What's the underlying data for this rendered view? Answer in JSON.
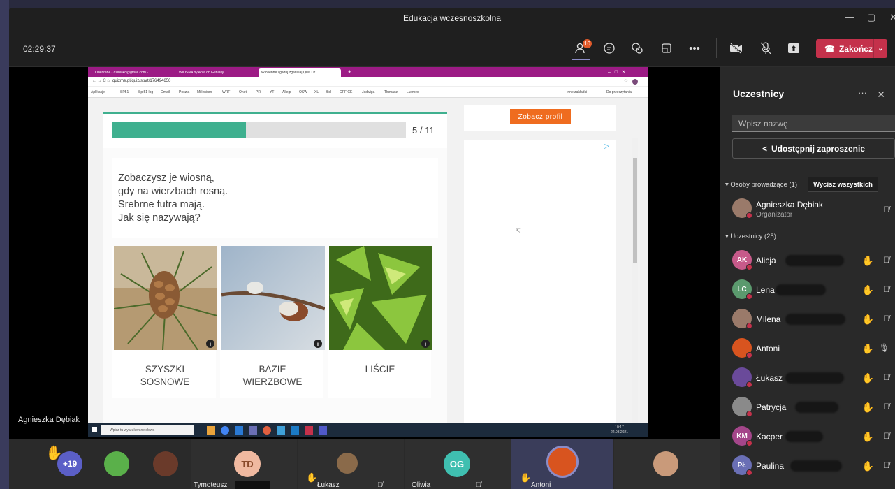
{
  "window": {
    "title": "Edukacja wczesnoszkolna"
  },
  "toolbar": {
    "time": "02:29:37",
    "participants_badge": "10",
    "end_label": "Zakończ"
  },
  "browser": {
    "tabs": [
      "Odebrane - dzibiako@gmail.com - ...",
      "WIOSNA by Ania on Genially",
      "Wiosenne zgaduj zgadula| Quiz Or..."
    ],
    "url": "quizme.pl/quiz/start/176494656",
    "bookmarks": [
      "Aplikacje",
      "SP51",
      "Sp 51 log",
      "Gmail",
      "Poczta",
      "Millenium",
      "WRF",
      "Onet",
      "PR",
      "YT",
      "Allegr",
      "OSW",
      "XL",
      "Bisl",
      "OFFICE",
      "Jadwiga",
      "Tłumacz",
      "Luxmed",
      "Inne zakładki",
      "Do przeczytania"
    ]
  },
  "quiz": {
    "progress": 0.4545,
    "counter": "5 / 11",
    "question": "Zobaczysz je wiosną,\ngdy na wierzbach rosną.\nSrebrne futra mają.\nJak się nazywają?",
    "answers": [
      {
        "label": "SZYSZKI\nSOSNOWE"
      },
      {
        "label": "BAZIE\nWIERZBOWE"
      },
      {
        "label": "LIŚCIE"
      }
    ],
    "profile_button": "Zobacz profil"
  },
  "windows_taskbar": {
    "search_placeholder": "Wpisz tu wyszukiwane słowa",
    "clock_time": "10:17",
    "clock_date": "22.03.2021"
  },
  "speaker_name": "Agnieszka Dębiak",
  "panel": {
    "title": "Uczestnicy",
    "search_placeholder": "Wpisz nazwę",
    "share_label": "Udostępnij zaproszenie",
    "presenters_header": "Osoby prowadzące (1)",
    "mute_all": "Wycisz wszystkich",
    "organizer": {
      "name": "Agnieszka Dębiak",
      "role": "Organizator"
    },
    "attendees_header": "Uczestnicy (25)",
    "attendees": [
      {
        "initials": "AK",
        "name": "Alicja",
        "color": "#c75a8a"
      },
      {
        "initials": "LC",
        "name": "Lena",
        "color": "#5b9a6e"
      },
      {
        "initials": "",
        "name": "Milena",
        "color": "#9a7a6a"
      },
      {
        "initials": "",
        "name": "Antoni",
        "color": "#d8541f"
      },
      {
        "initials": "",
        "name": "Łukasz",
        "color": "#6a4a9a"
      },
      {
        "initials": "",
        "name": "Patrycja",
        "color": "#8a8a8a"
      },
      {
        "initials": "KM",
        "name": "Kacper",
        "color": "#a4468a"
      },
      {
        "initials": "PŁ",
        "name": "Paulina",
        "color": "#6a6fb5"
      }
    ]
  },
  "bottom": {
    "overflow": "+19",
    "tiles": [
      {
        "initials": "TD",
        "name": "Tymoteusz"
      },
      {
        "initials": "",
        "name": "Łukasz"
      },
      {
        "initials": "OG",
        "name": "Oliwia"
      },
      {
        "initials": "",
        "name": "Antoni"
      }
    ]
  }
}
